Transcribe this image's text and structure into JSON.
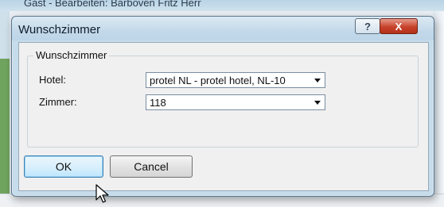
{
  "background": {
    "window_title": "Gast - Bearbeiten: Barboven Fritz Herr"
  },
  "dialog": {
    "title": "Wunschzimmer",
    "help_icon": "?",
    "close_icon": "X",
    "group_title": "Wunschzimmer",
    "fields": {
      "hotel_label": "Hotel:",
      "hotel_value": "protel NL - protel hotel, NL-10",
      "zimmer_label": "Zimmer:",
      "zimmer_value": "118"
    },
    "buttons": {
      "ok": "OK",
      "cancel": "Cancel"
    }
  },
  "colors": {
    "accent_close": "#c8432b",
    "default_button": "#bee6fd",
    "frame": "#c6dceb"
  }
}
